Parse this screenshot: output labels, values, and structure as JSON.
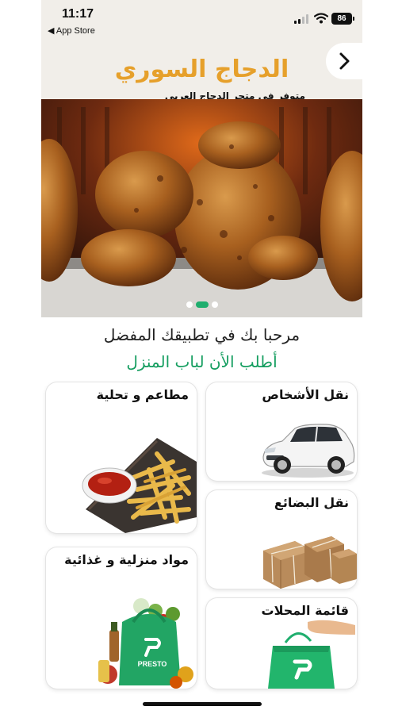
{
  "status_bar": {
    "time": "11:17",
    "back_app": "◀ App Store",
    "battery": "86"
  },
  "banner": {
    "title": "الدجاج السوري",
    "subtitle": "متوفر في متجر الدجاج العربي",
    "next_icon": "chevron-right-icon",
    "slides": 3,
    "active_slide": 2
  },
  "welcome": {
    "line1": "مرحبا بك في تطبيقك المفضل",
    "line2": "أطلب الأن لباب المنزل"
  },
  "categories": [
    {
      "label": "نقل الأشخاص"
    },
    {
      "label": "مطاعم و تحلية"
    },
    {
      "label": "نقل البضائع"
    },
    {
      "label": "مواد منزلية و غذائية"
    },
    {
      "label": "قائمة المحلات"
    }
  ],
  "bag_brand": "PRESTO",
  "colors": {
    "accent_green": "#1fae6e",
    "title_orange": "#e6a02b",
    "banner_bg": "#f1eee9"
  }
}
